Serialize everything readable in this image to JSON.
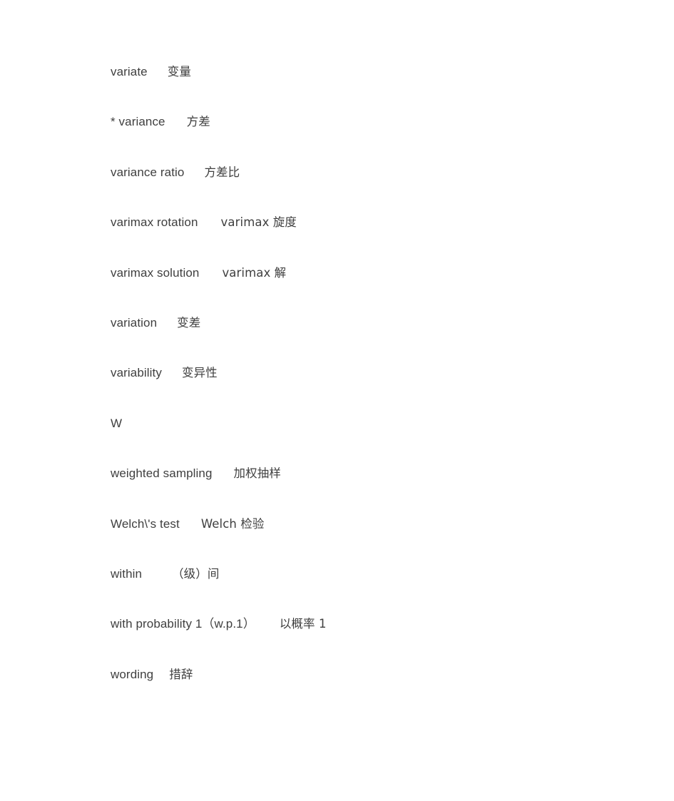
{
  "document": {
    "type": "bilingual-glossary",
    "background_color": "#ffffff",
    "text_color": "#3f3f3f",
    "entries": [
      {
        "id": "variate",
        "term": "variate",
        "translation": "变量"
      },
      {
        "id": "variance",
        "term": "* variance",
        "translation": "方差"
      },
      {
        "id": "variance-ratio",
        "term": "variance ratio",
        "translation": "方差比"
      },
      {
        "id": "varimax-rotation",
        "term": "varimax rotation",
        "translation": "varimax 旋度"
      },
      {
        "id": "varimax-solution",
        "term": "varimax solution",
        "translation": "varimax 解"
      },
      {
        "id": "variation",
        "term": "variation",
        "translation": "变差"
      },
      {
        "id": "variability",
        "term": "variability",
        "translation": "变异性"
      },
      {
        "id": "letter-w",
        "term": "W",
        "translation": ""
      },
      {
        "id": "weighted-sampling",
        "term": "weighted sampling",
        "translation": "加权抽样"
      },
      {
        "id": "welchs-test",
        "term": "Welch\\'s test",
        "translation": "Welch 检验"
      },
      {
        "id": "within",
        "term": "within",
        "translation": "（级）间"
      },
      {
        "id": "with-probability-1",
        "term": "with probability 1（w.p.1）",
        "translation": "以概率 1"
      },
      {
        "id": "wording",
        "term": "wording",
        "translation": "措辞"
      }
    ]
  }
}
